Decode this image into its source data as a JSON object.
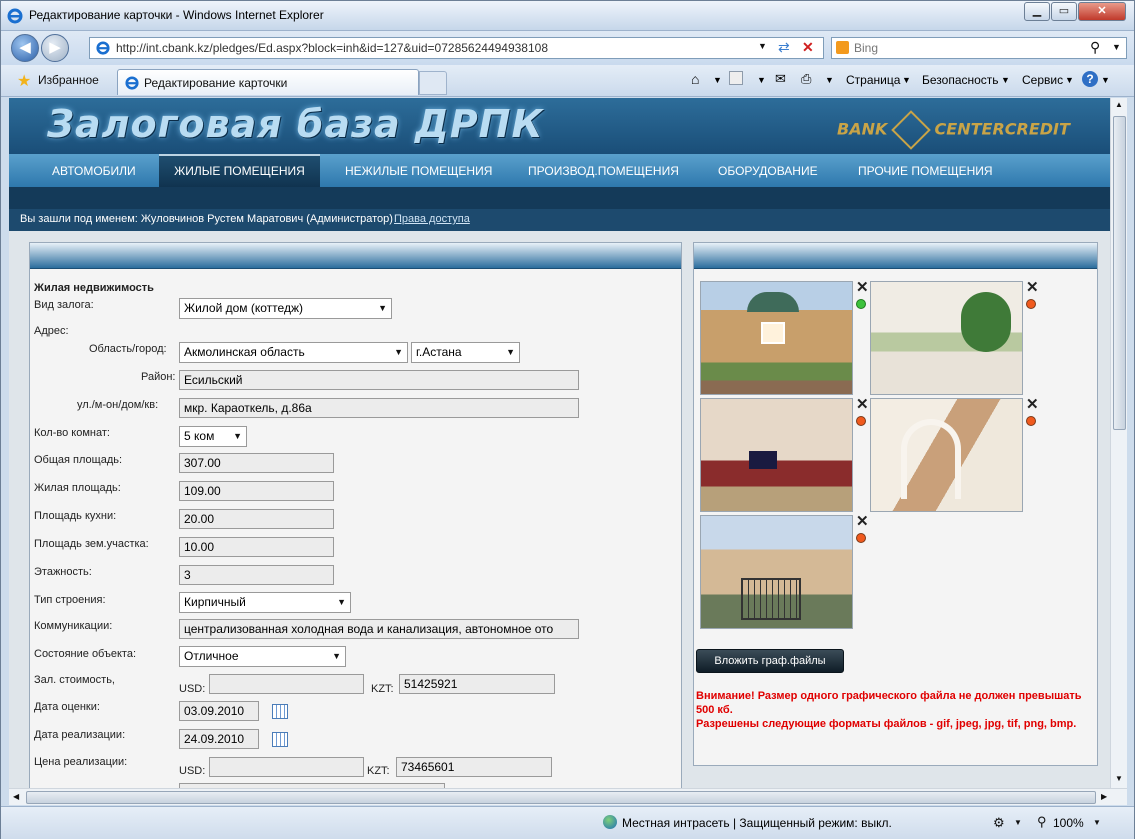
{
  "window": {
    "title": "Редактирование карточки - Windows Internet Explorer",
    "url": "http://int.cbank.kz/pledges/Ed.aspx?block=inh&id=127&uid=07285624494938108",
    "search_placeholder": "Bing"
  },
  "toolbar": {
    "favorites_label": "Избранное",
    "tab_title": "Редактирование карточки",
    "page_menu": "Страница",
    "safety_menu": "Безопасность",
    "tools_menu": "Сервис"
  },
  "banner": {
    "title": "Залоговая база ДРПК",
    "brand_left": "BANK",
    "brand_right": "CENTERCREDIT"
  },
  "nav": {
    "items": [
      "АВТОМОБИЛИ",
      "ЖИЛЫЕ ПОМЕЩЕНИЯ",
      "НЕЖИЛЫЕ ПОМЕЩЕНИЯ",
      "ПРОИЗВОД.ПОМЕЩЕНИЯ",
      "ОБОРУДОВАНИЕ",
      "ПРОЧИЕ ПОМЕЩЕНИЯ"
    ],
    "active": "ЖИЛЫЕ ПОМЕЩЕНИЯ"
  },
  "user": {
    "text": "Вы зашли под именем: Жуловчинов Рустем Маратович (Администратор)",
    "link": "Права доступа"
  },
  "form": {
    "section_title": "Жилая недвижимость",
    "pledge_type_label": "Вид залога:",
    "pledge_type": "Жилой дом (коттедж)",
    "address_label": "Адрес:",
    "region_label": "Область/город:",
    "region": "Акмолинская область",
    "city": "г.Астана",
    "district_label": "Район:",
    "district": "Есильский",
    "street_label": "ул./м-он/дом/кв:",
    "street": "мкр. Караоткель, д.86а",
    "rooms_label": "Кол-во комнат:",
    "rooms": "5 ком",
    "total_area_label": "Общая площадь:",
    "total_area": "307.00",
    "living_area_label": "Жилая площадь:",
    "living_area": "109.00",
    "kitchen_area_label": "Площадь кухни:",
    "kitchen_area": "20.00",
    "land_area_label": "Площадь зем.участка:",
    "land_area": "10.00",
    "floors_label": "Этажность:",
    "floors": "3",
    "building_type_label": "Тип строения:",
    "building_type": "Кирпичный",
    "utilities_label": "Коммуникации:",
    "utilities": "централизованная холодная вода и канализация, автономное ото",
    "condition_label": "Состояние объекта:",
    "condition": "Отличное",
    "pledge_value_label": "Зал. стоимость,",
    "usd_label": "USD:",
    "kzt_label": "KZT:",
    "pledge_value_usd": "",
    "pledge_value_kzt": "51425921",
    "appraisal_date_label": "Дата оценки:",
    "appraisal_date": "03.09.2010",
    "sale_date_label": "Дата реализации:",
    "sale_date": "24.09.2010",
    "sale_price_label": "Цена реализации:",
    "sale_price_usd": "",
    "sale_price_kzt": "73465601"
  },
  "photos": {
    "upload_button": "Вложить граф.файлы",
    "warning_line1": "Внимание! Размер одного графического файла не должен превышать 500 кб.",
    "warning_line2": "Разрешены следующие форматы файлов - gif, jpeg, jpg, tif, png, bmp.",
    "status_colors": [
      "#3cc23c",
      "#f05a1e",
      "#f05a1e",
      "#f05a1e",
      "#f05a1e"
    ]
  },
  "status": {
    "zone": "Местная интрасеть | Защищенный режим: выкл.",
    "zoom": "100%"
  }
}
